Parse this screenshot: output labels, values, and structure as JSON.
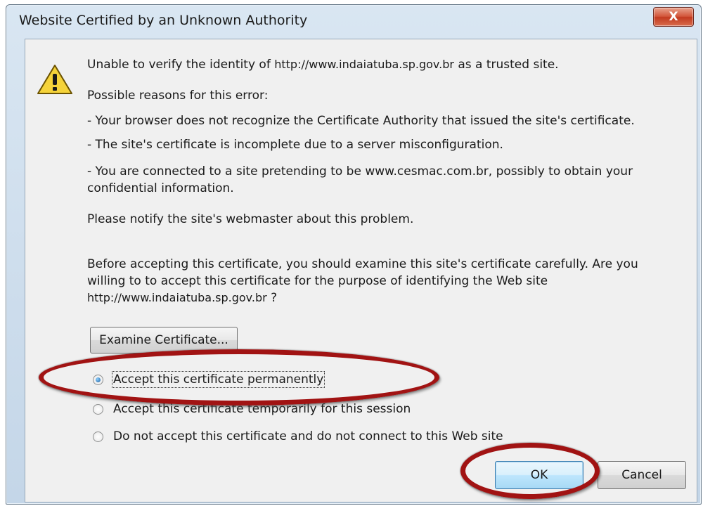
{
  "dialog": {
    "title": "Website Certified by an Unknown Authority",
    "close_label": "X",
    "icon": "warning-icon",
    "intro_prefix": "Unable to verify the identity of",
    "site_url": "http://www.indaiatuba.sp.gov.br",
    "intro_suffix": "as a trusted site.",
    "reasons_heading": "Possible reasons for this error:",
    "reason_1": "- Your browser does not recognize the Certificate Authority that issued the site's certificate.",
    "reason_2": "- The site's certificate is incomplete due to a server misconfiguration.",
    "reason_3_line1": "- You are connected to a site pretending to be www.cesmac.com.br, possibly to obtain your",
    "reason_3_line2": "confidential information.",
    "notify": "Please notify the site's webmaster about this problem.",
    "before_line1": "Before accepting this certificate, you should examine this site's certificate carefully. Are you",
    "before_line2": "willing to to accept this certificate for the purpose of identifying the Web site",
    "before_url": "http://www.indaiatuba.sp.gov.br",
    "before_qmark": "?",
    "examine_button": "Examine Certificate...",
    "options": [
      {
        "label": "Accept this certificate permanently",
        "checked": true
      },
      {
        "label": "Accept this certificate temporarily for this session",
        "checked": false
      },
      {
        "label": "Do not accept this certificate and do not connect to this Web site",
        "checked": false
      }
    ],
    "ok_button": "OK",
    "cancel_button": "Cancel"
  },
  "colors": {
    "annotation": "#a11313",
    "client_bg": "#f0f0f0",
    "close_button": "#c23a20"
  }
}
